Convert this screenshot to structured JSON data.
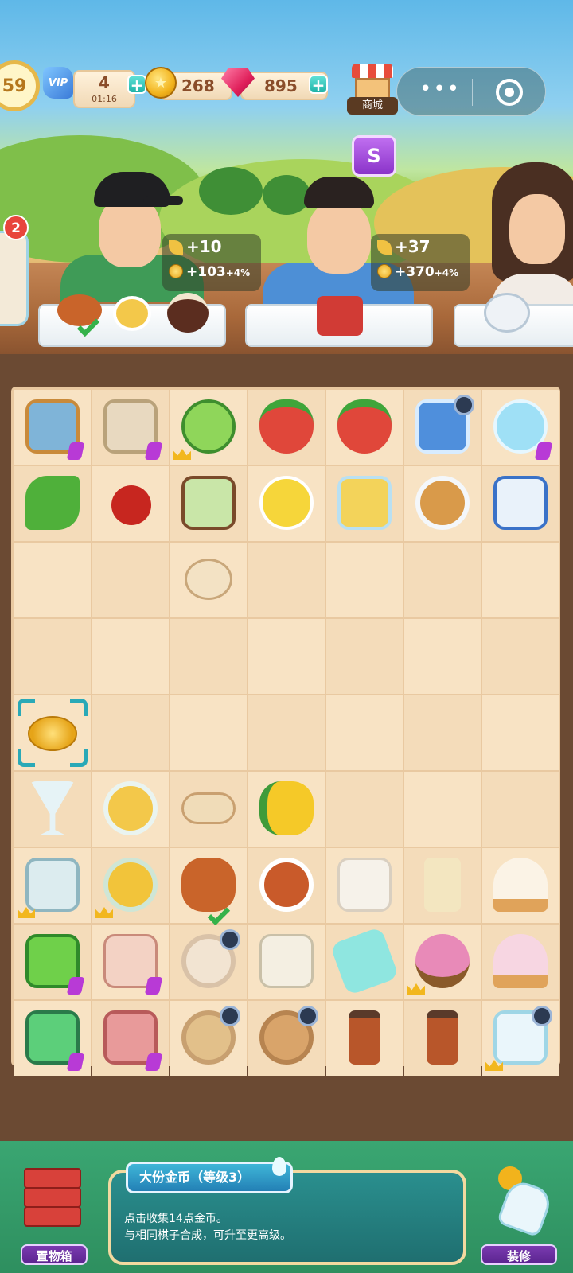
{
  "hud": {
    "level": "59",
    "vip_label": "VIP",
    "energy_value": "4",
    "energy_timer": "01:16",
    "energy_plus": "+",
    "coins": "268",
    "gems": "895",
    "gems_plus": "+",
    "shop_label": "商城",
    "menu_dots": "•••"
  },
  "event_badge": "S",
  "notification_count": "2",
  "customers": [
    {
      "wheat_reward": "+10",
      "coin_reward": "+103",
      "bonus": "+4%"
    },
    {
      "wheat_reward": "+37",
      "coin_reward": "+370",
      "bonus": "+4%"
    }
  ],
  "board": {
    "columns": 7,
    "rows": 9,
    "selected_item": "大份金币"
  },
  "bottom": {
    "storage_label": "置物箱",
    "decorate_label": "装修",
    "item_title": "大份金币（等级3）",
    "item_desc_line1": "点击收集14点金币。",
    "item_desc_line2": "与相同棋子合成，可升至更高级。"
  },
  "colors": {
    "accent_teal": "#2aa9b7",
    "coin_gold": "#f2b31c",
    "gem_red": "#e0205b",
    "purple": "#8a33c9",
    "panel_teal": "#1f6f70"
  }
}
